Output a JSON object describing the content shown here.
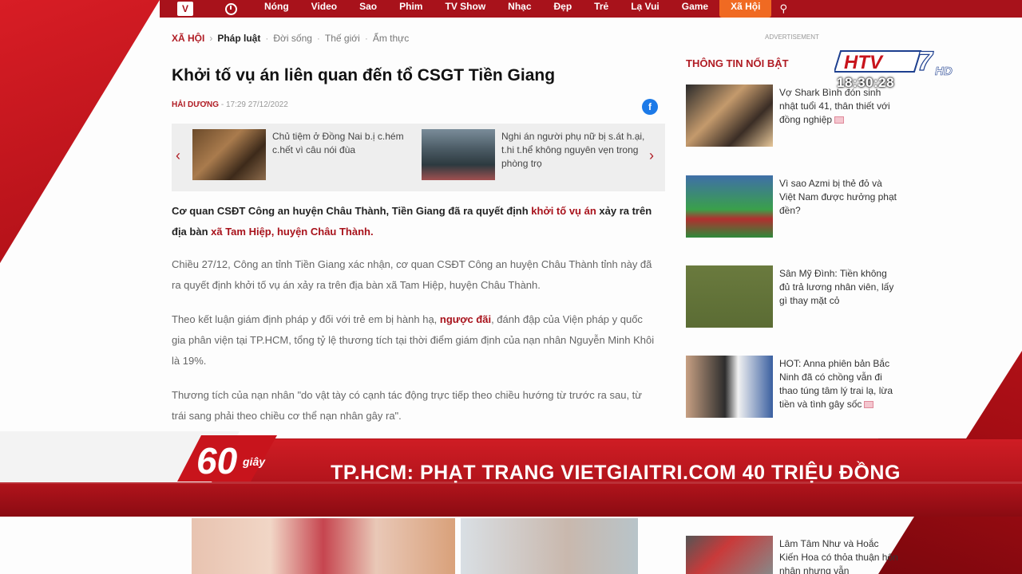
{
  "nav": {
    "logo": "V",
    "items": [
      "Nóng",
      "Video",
      "Sao",
      "Phim",
      "TV Show",
      "Nhạc",
      "Đẹp",
      "Trẻ",
      "Lạ Vui",
      "Game",
      "Xã Hội"
    ],
    "active": "Xã Hội",
    "search_icon": "search-icon"
  },
  "breadcrumb": {
    "category": "XÃ HỘI",
    "sub": "Pháp luật",
    "others": [
      "Đời sống",
      "Thế giới",
      "Ẩm thực"
    ]
  },
  "article": {
    "title": "Khởi tố vụ án liên quan đến tổ CSGT Tiền Giang",
    "author": "HẢI DƯƠNG",
    "datetime": "17:29 27/12/2022",
    "lead_1": "Cơ quan CSĐT Công an huyện Châu Thành, Tiền Giang đã ra quyết định ",
    "lead_link_1": "khởi tố vụ án",
    "lead_2": " xảy ra trên địa bàn ",
    "lead_link_2": "xã Tam Hiệp, huyện Châu Thành.",
    "para_1": "Chiều 27/12, Công an tỉnh Tiền Giang xác nhận, cơ quan CSĐT Công an huyện Châu Thành tỉnh này đã ra quyết định khởi tố vụ án xảy ra trên địa bàn xã Tam Hiệp, huyện Châu Thành.",
    "para_2a": "Theo kết luận giám định pháp y đối với trẻ em bị hành hạ, ",
    "para_2_link": "ngược đãi",
    "para_2b": ", đánh đập của Viện pháp y quốc gia phân viện tại TP.HCM, tổng tỷ lệ thương tích tại thời điểm giám định của nạn nhân Nguyễn Minh Khôi là 19%.",
    "para_3": "Thương tích của nạn nhân \"do vật tày có cạnh tác động trực tiếp theo chiều hướng từ trước ra sau, từ trái sang phải theo chiều cơ thể nạn nhân gây ra\"."
  },
  "related": [
    {
      "text": "Chủ tiệm ở Đồng Nai b.ị c.hém c.hết vì câu nói đùa"
    },
    {
      "text": "Nghi án người phụ nữ bị s.át h.ại, t.hi t.hể không nguyên vẹn trong phòng trọ"
    }
  ],
  "sidebar": {
    "ad_label": "ADVERTISEMENT",
    "heading": "THÔNG TIN NỔI BẬT",
    "items": [
      {
        "text": "Vợ Shark Bình đón sinh nhật tuổi 41, thân thiết với đồng nghiệp"
      },
      {
        "text": "Vì sao Azmi bị thẻ đỏ và Việt Nam được hưởng phạt đền?"
      },
      {
        "text": "Sân Mỹ Đình: Tiền không đủ trả lương nhân viên, lấy gì thay mặt cỏ"
      },
      {
        "text": "HOT: Anna phiên bản Bắc Ninh đã có chồng vẫn đi thao túng tâm lý trai lạ, lừa tiền và tình gây sốc"
      },
      {
        "text": "Lâm Tâm Như và Hoắc Kiến Hoa có thỏa thuận hôn nhân nhưng vẫn"
      }
    ]
  },
  "broadcast": {
    "channel": "HTV",
    "channel_number": "7",
    "hd": "HD",
    "time": "18:30:28",
    "show_logo_number": "60",
    "show_logo_text": "giây",
    "headline": "TP.HCM: PHẠT TRANG VIETGIAITRI.COM 40 TRIỆU ĐỒNG"
  },
  "colors": {
    "brand_red": "#a8121b",
    "nav_active": "#f06a22",
    "facebook": "#1c7ae8"
  }
}
